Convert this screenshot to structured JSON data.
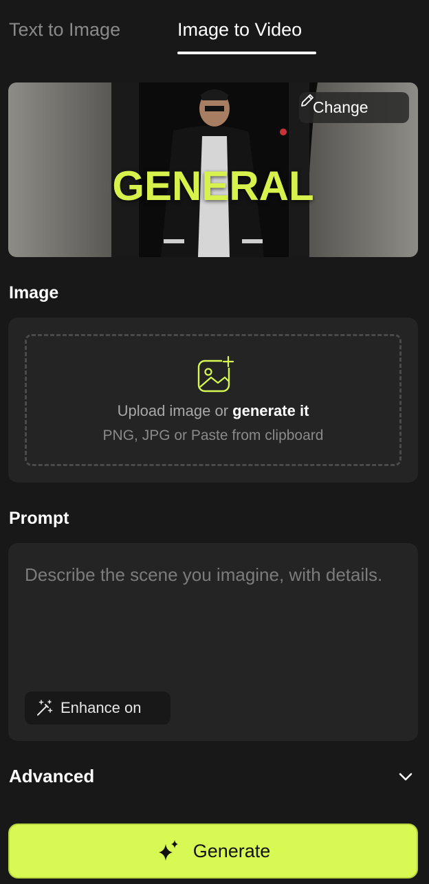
{
  "tabs": [
    {
      "label": "Text to Image",
      "active": false
    },
    {
      "label": "Image to Video",
      "active": true
    }
  ],
  "preview": {
    "overlay_text": "GENERAL",
    "change_label": "Change"
  },
  "image_section": {
    "title": "Image",
    "upload_prefix": "Upload image or ",
    "upload_link": "generate it",
    "upload_hint": "PNG, JPG or Paste from clipboard"
  },
  "prompt_section": {
    "title": "Prompt",
    "placeholder": "Describe the scene you imagine, with details.",
    "enhance_label": "Enhance on"
  },
  "advanced": {
    "label": "Advanced"
  },
  "generate": {
    "label": "Generate"
  },
  "colors": {
    "accent": "#d8f853",
    "background": "#181818",
    "card": "#242424"
  }
}
